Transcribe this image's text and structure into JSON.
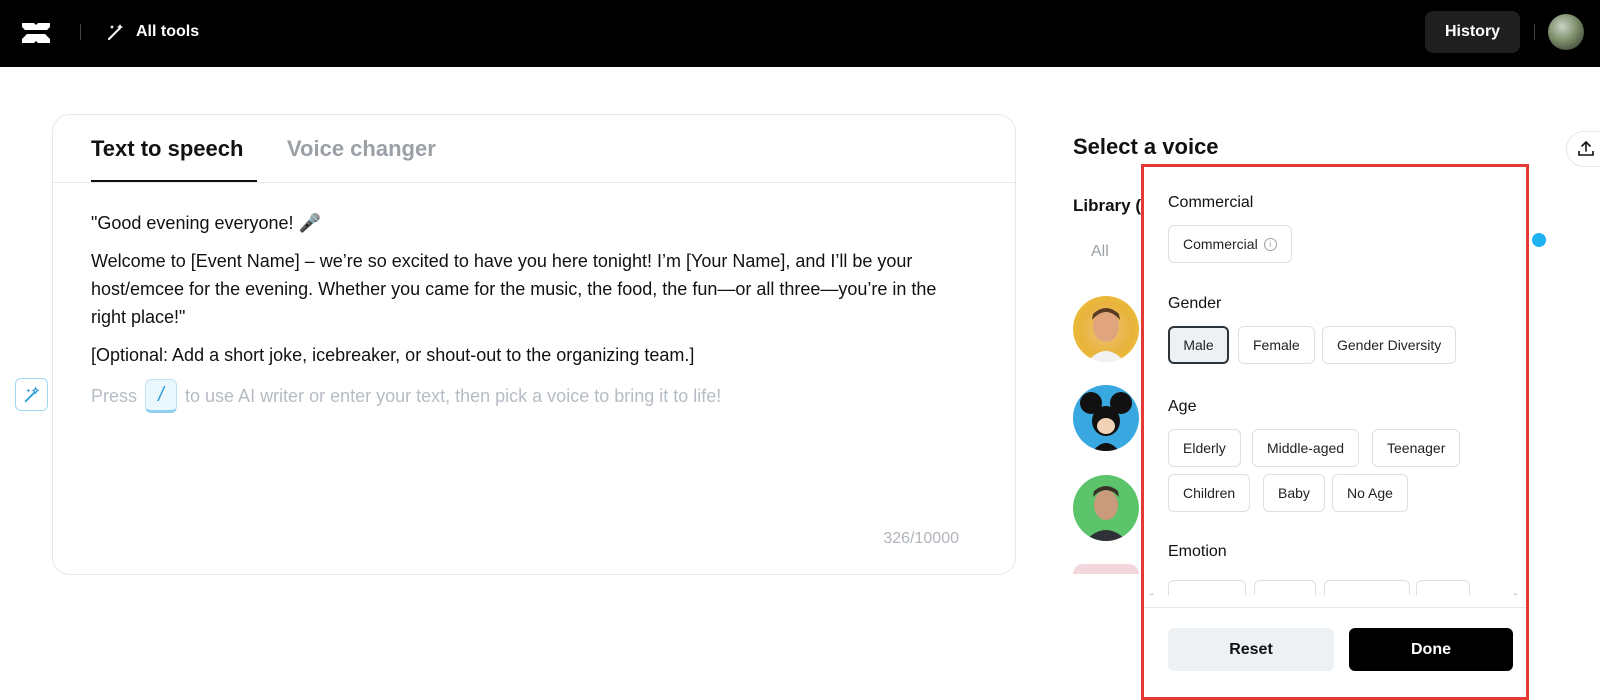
{
  "topbar": {
    "logo_icon": "capcut-logo-icon",
    "all_tools_label": "All tools",
    "all_tools_icon": "magic-wand-icon",
    "history_label": "History"
  },
  "editor": {
    "tabs": [
      {
        "label": "Text to speech",
        "active": true
      },
      {
        "label": "Voice changer",
        "active": false
      }
    ],
    "paragraphs": [
      "\"Good evening everyone! 🎤",
      " Welcome to [Event Name] – we’re so excited to have you here tonight! I’m [Your Name], and I’ll be your host/emcee for the evening. Whether you came for the music, the food, the fun—or all three—you’re in the right place!\"",
      "[Optional: Add a short joke, icebreaker, or shout-out to the organizing team.]"
    ],
    "placeholder_prefix": "Press",
    "slash_key": "/",
    "placeholder_suffix": "to use AI writer or enter your text, then pick a voice to bring it to life!",
    "counter": "326/10000"
  },
  "voices": {
    "title": "Select a voice",
    "library_label": "Library (",
    "all_label": "All"
  },
  "filter_popup": {
    "sections": {
      "commercial": {
        "title": "Commercial",
        "options": [
          "Commercial"
        ]
      },
      "gender": {
        "title": "Gender",
        "options": [
          "Male",
          "Female",
          "Gender Diversity"
        ],
        "selected": "Male"
      },
      "age": {
        "title": "Age",
        "options": [
          "Elderly",
          "Middle-aged",
          "Teenager",
          "Children",
          "Baby",
          "No Age"
        ]
      },
      "emotion": {
        "title": "Emotion"
      }
    },
    "reset_label": "Reset",
    "done_label": "Done"
  },
  "colors": {
    "topbar_bg": "#000000",
    "accent_blue": "#1fb2f0",
    "highlight_border": "#e53935"
  }
}
